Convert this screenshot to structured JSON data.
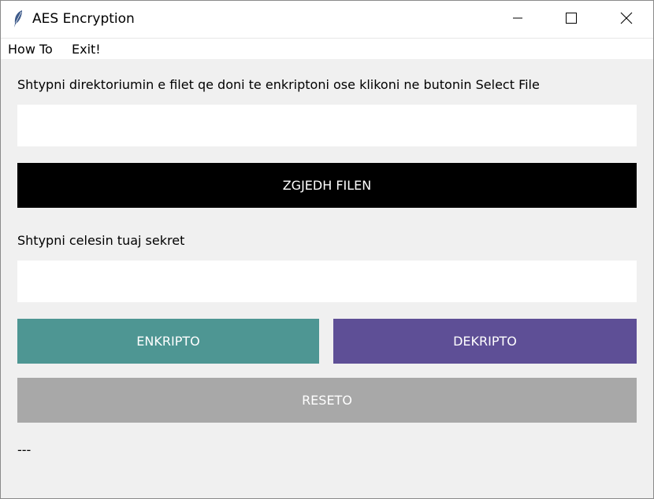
{
  "window": {
    "title": "AES Encryption",
    "icon": "feather-icon"
  },
  "menu": {
    "items": [
      "How To",
      "Exit!"
    ]
  },
  "main": {
    "path_label": "Shtypni direktoriumin e filet qe doni te enkriptoni ose klikoni ne butonin Select File",
    "path_value": "",
    "select_button": "ZGJEDH FILEN",
    "key_label": "Shtypni celesin tuaj sekret",
    "key_value": "",
    "encrypt_button": "ENKRIPTO",
    "decrypt_button": "DEKRIPTO",
    "reset_button": "RESETO",
    "status": "---"
  },
  "colors": {
    "select": "#000000",
    "encrypt": "#4e9693",
    "decrypt": "#5e4f96",
    "reset": "#a8a8a8"
  }
}
